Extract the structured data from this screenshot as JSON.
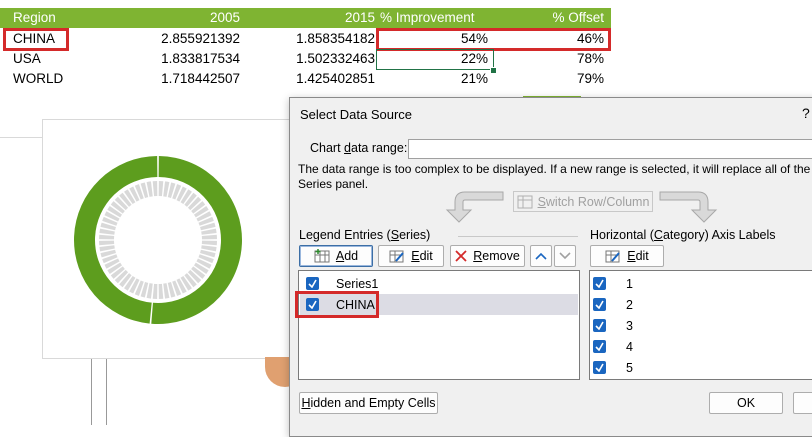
{
  "sheet": {
    "headers": [
      "Region",
      "2005",
      "2015",
      "% Improvement",
      "% Offset"
    ],
    "rows": [
      [
        "CHINA",
        "2.855921392",
        "1.858354182",
        "54%",
        "46%"
      ],
      [
        "USA",
        "1.833817534",
        "1.502332463",
        "22%",
        "78%"
      ],
      [
        "WORLD",
        "1.718442507",
        "1.425402851",
        "21%",
        "79%"
      ]
    ]
  },
  "chart_colors": {
    "outer_ring": "#5d9d1e",
    "inner_ring": "#d9d9d9"
  },
  "colors": {
    "header_green": "#7fb432",
    "highlight_red": "#d42a2a",
    "checkbox_blue": "#1a66c0"
  },
  "dialog": {
    "title": "Select Data Source",
    "help": "?",
    "range_label": "Chart data range:",
    "range_value": "",
    "message_line1": "The data range is too complex to be displayed. If a new range is selected, it will replace all of the ser",
    "message_line2": "Series panel.",
    "switch_button": "Switch Row/Column",
    "legend_section": "Legend Entries (Series)",
    "axis_section": "Horizontal (Category) Axis Labels",
    "add_button": "Add",
    "edit_button": "Edit",
    "remove_button": "Remove",
    "axis_edit_button": "Edit",
    "series": [
      "Series1",
      "CHINA"
    ],
    "categories": [
      "1",
      "2",
      "3",
      "4",
      "5"
    ],
    "hidden_cells_button": "Hidden and Empty Cells",
    "ok_button": "OK"
  }
}
